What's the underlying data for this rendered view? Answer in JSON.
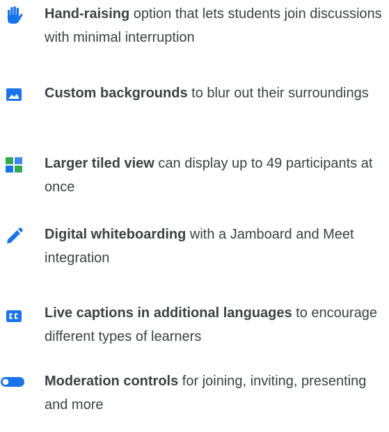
{
  "accent_color": "#1a73e8",
  "text_color": "#3c4043",
  "features": [
    {
      "icon": "hand-raise-icon",
      "title": "Hand-raising",
      "description": " option that lets students join discussions with minimal interruption"
    },
    {
      "icon": "image-icon",
      "title": "Custom backgrounds",
      "description": " to blur out their surroundings"
    },
    {
      "icon": "tiled-view-icon",
      "title": "Larger tiled view",
      "description": " can display up to 49 participants at once"
    },
    {
      "icon": "pencil-icon",
      "title": "Digital whiteboarding",
      "description": " with a Jamboard and Meet integration"
    },
    {
      "icon": "closed-captions-icon",
      "title": "Live captions in additional languages",
      "description": " to encourage different types of learners"
    },
    {
      "icon": "toggle-icon",
      "title": "Moderation controls",
      "description": " for joining, inviting, presenting and more"
    }
  ]
}
